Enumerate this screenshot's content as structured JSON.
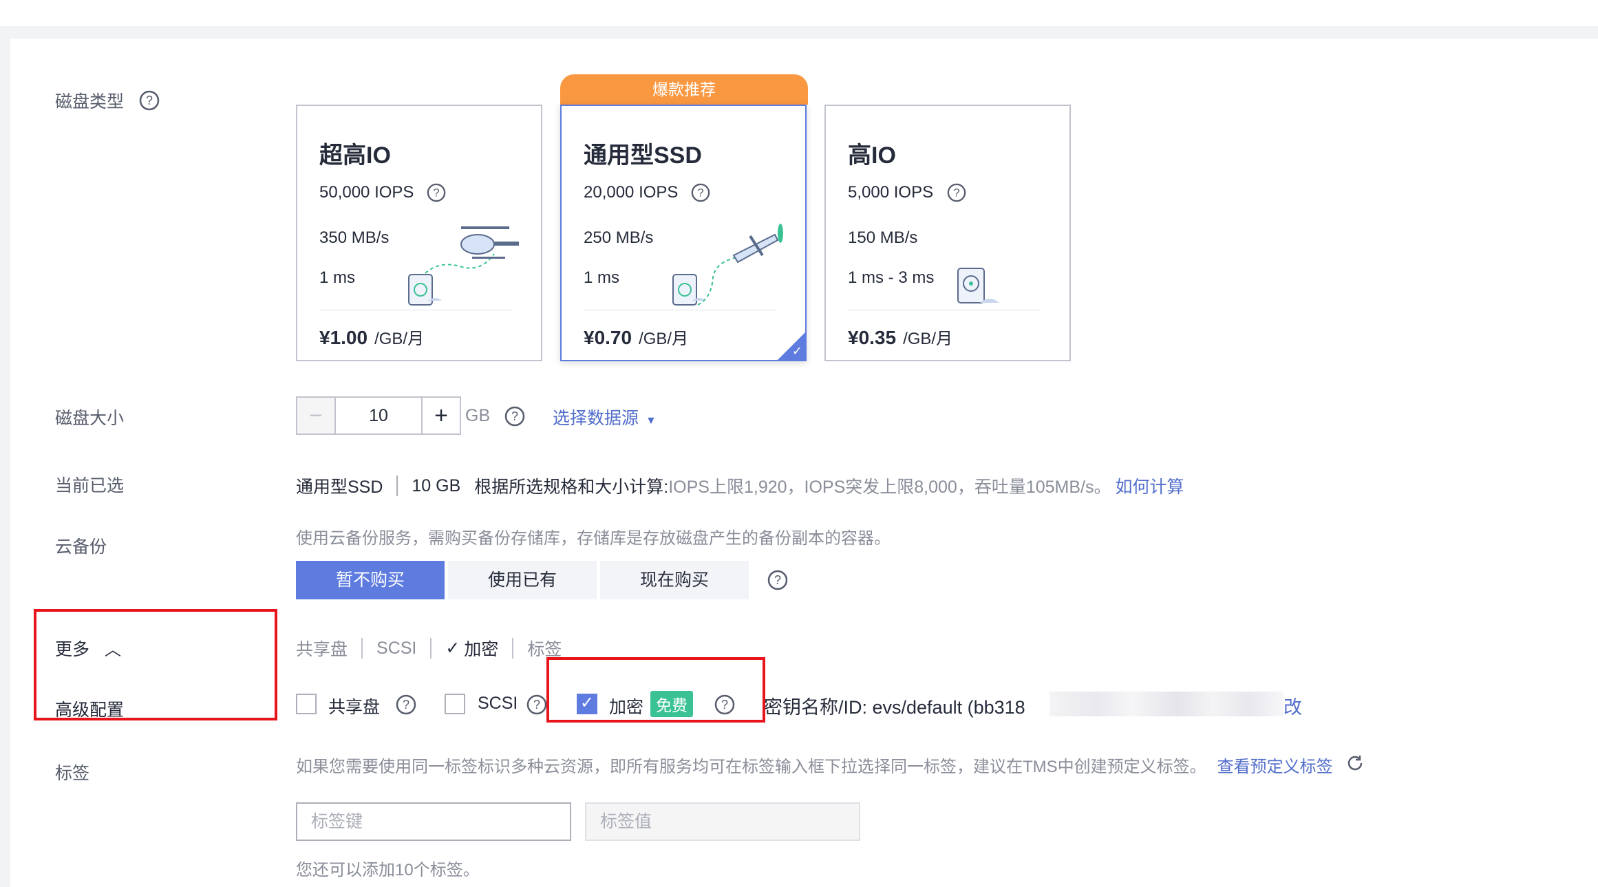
{
  "labels": {
    "disk_type": "磁盘类型",
    "disk_size": "磁盘大小",
    "current_selected": "当前已选",
    "cloud_backup": "云备份",
    "more": "更多",
    "advanced": "高级配置",
    "tags": "标签"
  },
  "badge": "爆款推荐",
  "cards": [
    {
      "name": "超高IO",
      "iops": "50,000 IOPS",
      "throughput": "350 MB/s",
      "latency": "1 ms",
      "price": "¥1.00",
      "unit": "/GB/月"
    },
    {
      "name": "通用型SSD",
      "iops": "20,000 IOPS",
      "throughput": "250 MB/s",
      "latency": "1 ms",
      "price": "¥0.70",
      "unit": "/GB/月"
    },
    {
      "name": "高IO",
      "iops": "5,000 IOPS",
      "throughput": "150 MB/s",
      "latency": "1 ms - 3 ms",
      "price": "¥0.35",
      "unit": "/GB/月"
    }
  ],
  "size": {
    "value": "10",
    "unit": "GB",
    "select_source": "选择数据源"
  },
  "summary": {
    "type": "通用型SSD",
    "size": "10 GB",
    "calc_prefix": "根据所选规格和大小计算:",
    "detail": "IOPS上限1,920，IOPS突发上限8,000，吞吐量105MB/s。",
    "how_link": "如何计算"
  },
  "backup": {
    "desc": "使用云备份服务，需购买备份存储库，存储库是存放磁盘产生的备份副本的容器。",
    "options": [
      "暂不购买",
      "使用已有",
      "现在购买"
    ]
  },
  "advanced_tabs": [
    "共享盘",
    "SCSI",
    "加密",
    "标签"
  ],
  "options": {
    "shared": "共享盘",
    "scsi": "SCSI",
    "encrypt": "加密",
    "free_tag": "免费",
    "key_text": "密钥名称/ID: evs/default (bb318",
    "key_tail": "改"
  },
  "tags": {
    "desc": "如果您需要使用同一标签标识多种云资源，即所有服务均可在标签输入框下拉选择同一标签，建议在TMS中创建预定义标签。",
    "view_link": "查看预定义标签",
    "key_placeholder": "标签键",
    "value_placeholder": "标签值",
    "remaining": "您还可以添加10个标签。"
  },
  "colors": {
    "primary": "#5e7ce0",
    "badge": "#fa9841",
    "highlight": "#e8141b",
    "free": "#3ac295"
  }
}
